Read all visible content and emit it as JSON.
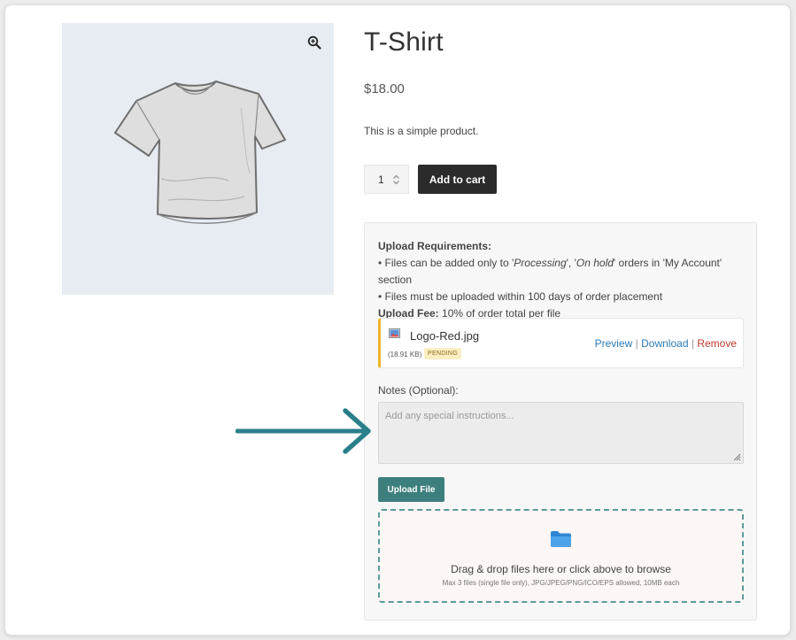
{
  "product": {
    "title": "T-Shirt",
    "price": "$18.00",
    "description": "This is a simple product.",
    "quantity": "1",
    "add_to_cart_label": "Add to cart"
  },
  "upload": {
    "requirements_heading": "Upload Requirements:",
    "bullet1_prefix": "• Files can be added only to '",
    "bullet1_status1": "Processing",
    "bullet1_sep": "', '",
    "bullet1_status2": "On hold",
    "bullet1_suffix": "' orders in 'My Account' section",
    "bullet2": "• Files must be uploaded within 100 days of order placement",
    "fee_label": "Upload Fee:",
    "fee_value": "10% of order total per file",
    "file": {
      "name": "Logo-Red.jpg",
      "size": "(18.91 KB)",
      "status": "PENDING",
      "preview_label": "Preview",
      "download_label": "Download",
      "remove_label": "Remove",
      "separator": "|"
    },
    "notes_label": "Notes (Optional):",
    "notes_placeholder": "Add any special instructions...",
    "upload_button_label": "Upload File",
    "dropzone_text": "Drag & drop files here or click above to browse",
    "dropzone_subtext": "Max 3 files (single file only), JPG/JPEG/PNG/ICO/EPS allowed, 10MB each"
  },
  "icons": {
    "zoom": "magnifier-plus-icon",
    "file": "image-file-icon",
    "folder": "folder-icon",
    "arrow": "annotation-arrow"
  },
  "colors": {
    "accent_teal": "#3d7f7d",
    "arrow": "#2a7f8a",
    "pending_border": "#f0b429",
    "link": "#2a7ab8",
    "remove": "#c0392b"
  }
}
